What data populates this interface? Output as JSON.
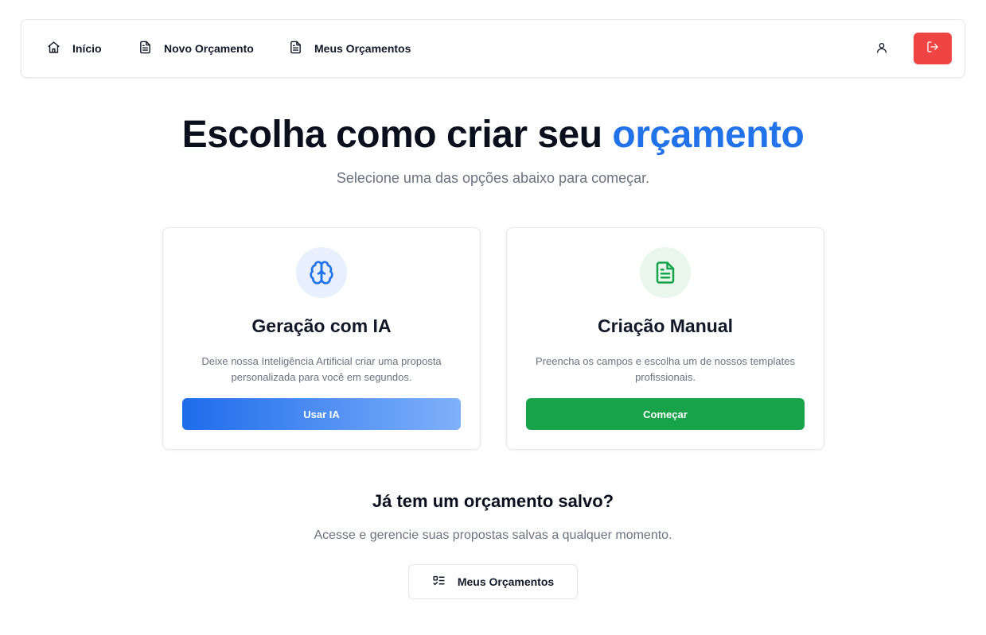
{
  "nav": {
    "items": [
      {
        "label": "Início",
        "icon": "home-icon"
      },
      {
        "label": "Novo Orçamento",
        "icon": "file-text-icon"
      },
      {
        "label": "Meus Orçamentos",
        "icon": "file-text-icon"
      }
    ],
    "user_icon": "user-icon",
    "logout_icon": "logout-icon"
  },
  "hero": {
    "title_main": "Escolha como criar seu",
    "title_accent": "orçamento",
    "subtitle": "Selecione uma das opções abaixo para começar."
  },
  "cards": [
    {
      "icon": "brain-icon",
      "title": "Geração com IA",
      "description": "Deixe nossa Inteligência Artificial criar uma proposta personalizada para você em segundos.",
      "button": "Usar IA"
    },
    {
      "icon": "file-text-icon",
      "title": "Criação Manual",
      "description": "Preencha os campos e escolha um de nossos templates profissionais.",
      "button": "Começar"
    }
  ],
  "saved": {
    "title": "Já tem um orçamento salvo?",
    "subtitle": "Acesse e gerencie suas propostas salvas a qualquer momento.",
    "button": "Meus Orçamentos",
    "button_icon": "list-todo-icon"
  },
  "colors": {
    "accent": "#2272ea",
    "danger": "#ef4444",
    "success": "#16a34a"
  }
}
